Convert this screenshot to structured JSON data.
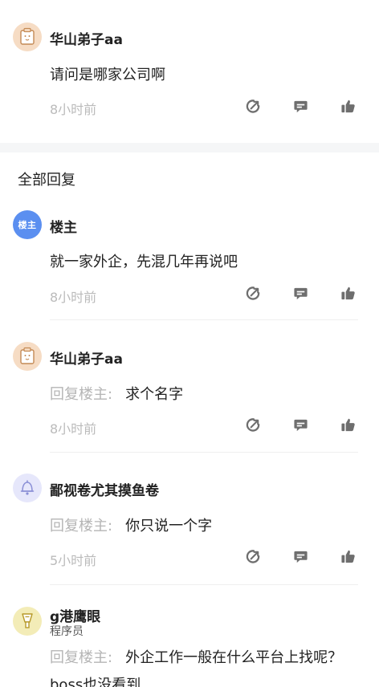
{
  "top_comment": {
    "author": "华山弟子aa",
    "text": "请问是哪家公司啊",
    "time": "8小时前"
  },
  "section_title": "全部回复",
  "host_badge": "楼主",
  "comments": [
    {
      "author": "楼主",
      "text": "就一家外企，先混几年再说吧",
      "time": "8小时前"
    },
    {
      "author": "华山弟子aa",
      "reply_prefix": "回复楼主:",
      "text": "求个名字",
      "time": "8小时前"
    },
    {
      "author": "鄙视卷尤其摸鱼卷",
      "reply_prefix": "回复楼主:",
      "text": "你只说一个字",
      "time": "5小时前"
    },
    {
      "author": "g港鹰眼",
      "subtitle": "程序员",
      "reply_prefix": "回复楼主:",
      "text": "外企工作一般在什么平台上找呢？boss也没看到"
    }
  ],
  "icons": {
    "share": "share-arrow-icon",
    "reply": "comment-bubble-icon",
    "like": "thumbs-up-icon"
  },
  "colors": {
    "host_avatar": "#5b8ff0",
    "icon_gray": "#6e6e6e",
    "muted_text": "#bbbbbb"
  }
}
